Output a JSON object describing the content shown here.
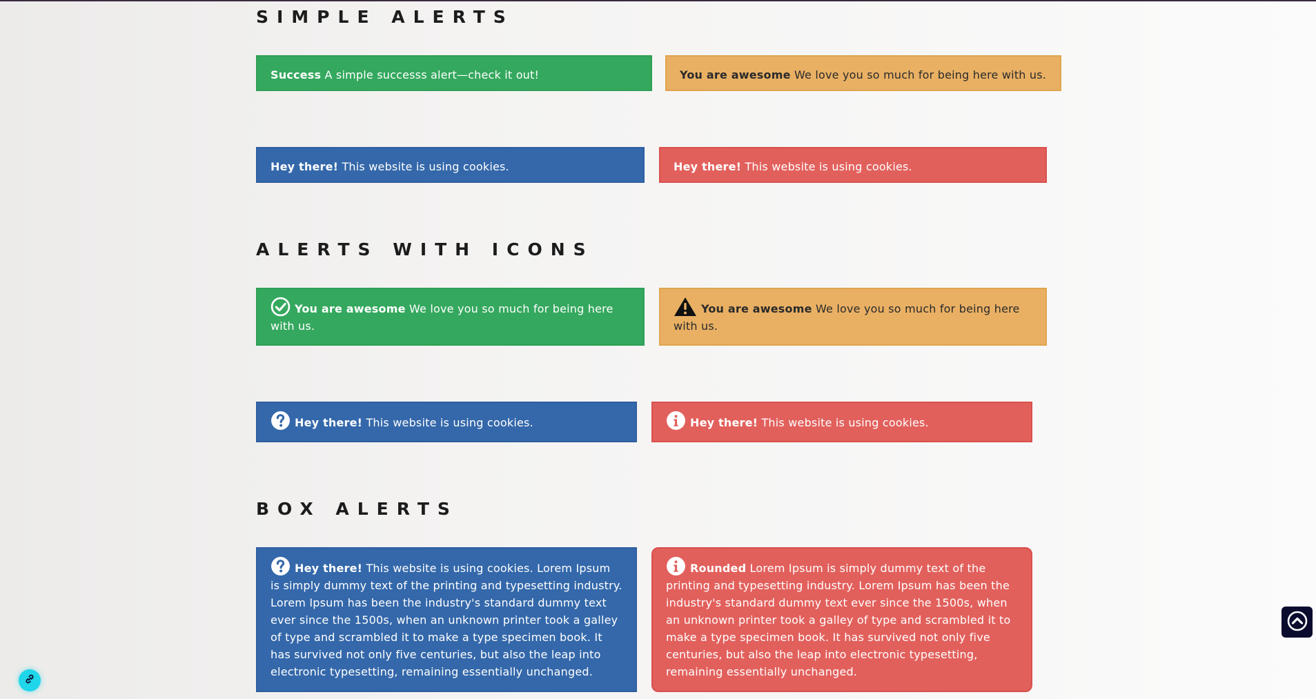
{
  "sections": {
    "simple": {
      "title": "SIMPLE ALERTS",
      "success": {
        "strong": "Success",
        "text": " A simple successs alert—check it out!"
      },
      "awesome": {
        "strong": "You are awesome",
        "text": " We love you so much for being here with us."
      },
      "info": {
        "strong": "Hey there!",
        "text": " This website is using cookies."
      },
      "danger": {
        "strong": "Hey there!",
        "text": " This website is using cookies."
      }
    },
    "icons": {
      "title": "ALERTS WITH ICONS",
      "success": {
        "strong": "You are awesome",
        "text": " We love you so much for being here with us."
      },
      "warning": {
        "strong": "You are awesome",
        "text": " We love you so much for being here with us."
      },
      "info": {
        "strong": "Hey there!",
        "text": " This website is using cookies."
      },
      "danger": {
        "strong": "Hey there!",
        "text": " This website is using cookies."
      }
    },
    "box": {
      "title": "BOX ALERTS",
      "info": {
        "strong": "Hey there!",
        "text": " This website is using cookies. Lorem Ipsum is simply dummy text of the printing and typesetting industry. Lorem Ipsum has been the industry's standard dummy text ever since the 1500s, when an unknown printer took a galley of type and scrambled it to make a type specimen book. It has survived not only five centuries, but also the leap into electronic typesetting, remaining essentially unchanged."
      },
      "rounded": {
        "strong": "Rounded",
        "text": " Lorem Ipsum is simply dummy text of the printing and typesetting industry. Lorem Ipsum has been the industry's standard dummy text ever since the 1500s, when an unknown printer took a galley of type and scrambled it to make a type specimen book. It has survived not only five centuries, but also the leap into electronic typesetting, remaining essentially unchanged."
      }
    }
  },
  "icons": {
    "check": "check-circle-icon",
    "warning": "warning-triangle-icon",
    "question": "question-circle-icon",
    "info": "info-circle-icon",
    "scroll_top": "chevron-up-circle-icon",
    "link": "link-icon"
  },
  "colors": {
    "success": "#34a85e",
    "warning": "#e9b064",
    "info": "#3468aa",
    "danger": "#e2605c",
    "scroll_top_bg": "#0b0b2e",
    "link_fab_bg": "#1fd6ea"
  }
}
